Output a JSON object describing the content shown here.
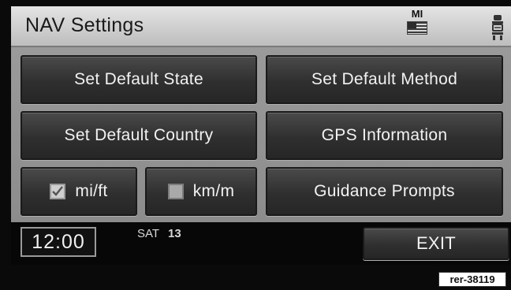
{
  "header": {
    "title": "NAV Settings",
    "state_code": "MI"
  },
  "buttons": {
    "set_default_state": "Set Default State",
    "set_default_method": "Set Default Method",
    "set_default_country": "Set Default Country",
    "gps_information": "GPS Information",
    "guidance_prompts": "Guidance Prompts"
  },
  "units": {
    "mi_ft": {
      "label": "mi/ft",
      "checked": true
    },
    "km_m": {
      "label": "km/m",
      "checked": false
    }
  },
  "footer": {
    "time": "12:00",
    "day": "SAT",
    "date": "13",
    "exit_label": "EXIT"
  },
  "reference_code": "rer-38119",
  "icons": [
    "flag-icon",
    "seat-icon",
    "checkbox-checked-icon",
    "checkbox-unchecked-icon"
  ]
}
